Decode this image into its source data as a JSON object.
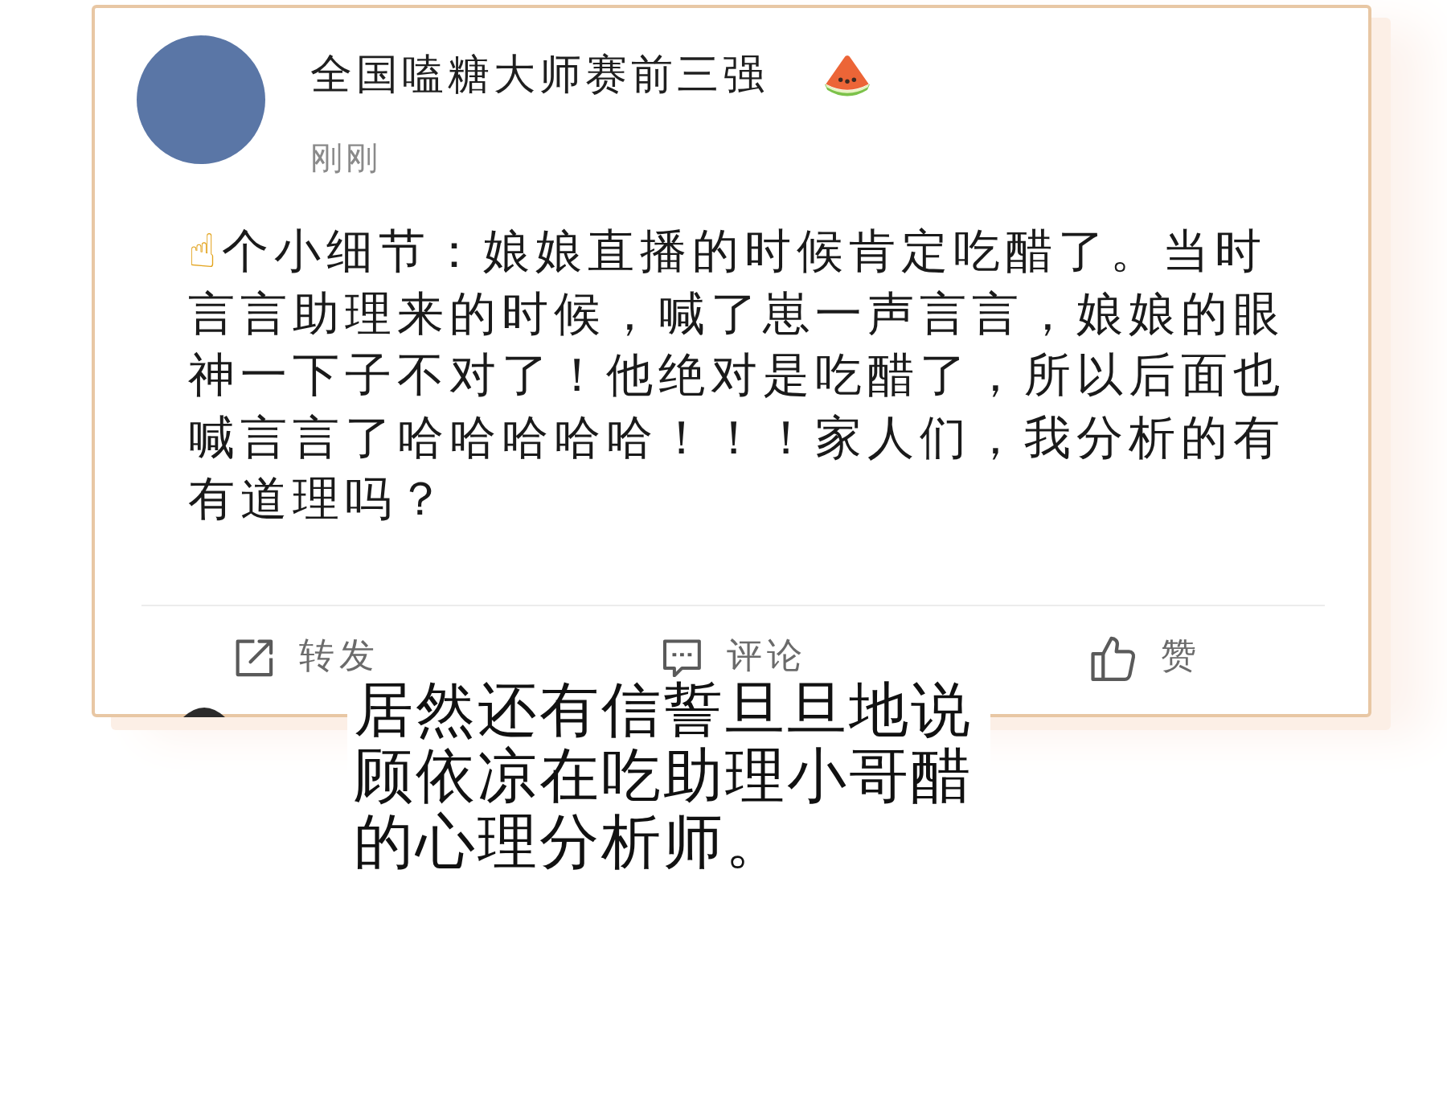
{
  "post": {
    "author": {
      "name": "全国嗑糖大师赛前三强"
    },
    "time": "刚刚",
    "text": "☝个小细节：娘娘直播的时候肯定吃醋了。当时言言助理来的时候，喊了崽一声言言，娘娘的眼神一下子不对了！他绝对是吃醋了，所以后面也喊言言了哈哈哈哈哈！！！家人们，我分析的有有道理吗？",
    "actions": [
      {
        "kind": "repost",
        "label": "转发"
      },
      {
        "kind": "comment",
        "label": "评论"
      },
      {
        "kind": "like",
        "label": "赞"
      }
    ]
  },
  "caption": "居然还有信誓旦旦地说顾依凉在吃助理小哥醋的心理分析师。"
}
